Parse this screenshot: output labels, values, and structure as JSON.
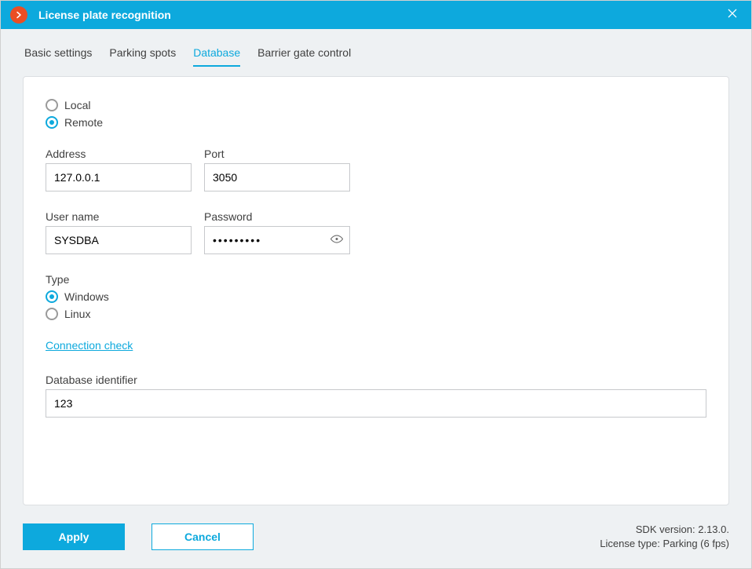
{
  "titlebar": {
    "title": "License plate recognition"
  },
  "tabs": {
    "items": [
      {
        "label": "Basic settings"
      },
      {
        "label": "Parking spots"
      },
      {
        "label": "Database"
      },
      {
        "label": "Barrier gate control"
      }
    ],
    "active_index": 2
  },
  "db": {
    "location": {
      "local_label": "Local",
      "remote_label": "Remote",
      "selected": "remote"
    },
    "address": {
      "label": "Address",
      "value": "127.0.0.1"
    },
    "port": {
      "label": "Port",
      "value": "3050"
    },
    "username": {
      "label": "User name",
      "value": "SYSDBA"
    },
    "password": {
      "label": "Password",
      "value": "•••••••••"
    },
    "type": {
      "label": "Type",
      "windows_label": "Windows",
      "linux_label": "Linux",
      "selected": "windows"
    },
    "connection_check_label": "Connection check",
    "identifier": {
      "label": "Database identifier",
      "value": "123"
    }
  },
  "footer": {
    "apply_label": "Apply",
    "cancel_label": "Cancel",
    "sdk_line": "SDK version: 2.13.0.",
    "license_line": "License type: Parking (6 fps)"
  }
}
